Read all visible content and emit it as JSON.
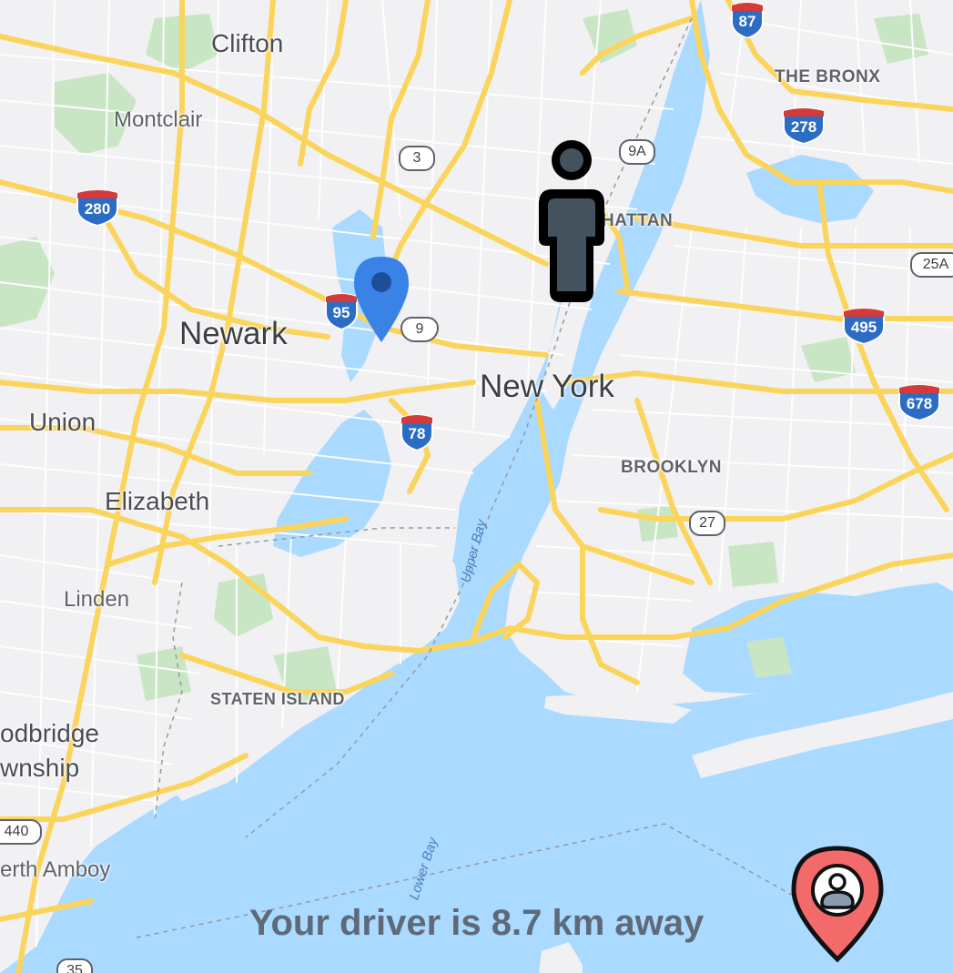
{
  "map": {
    "labels": {
      "clifton": "Clifton",
      "montclair": "Montclair",
      "the_bronx": "THE BRONX",
      "manhattan": "HATTAN",
      "newark": "Newark",
      "new_york": "New York",
      "union": "Union",
      "elizabeth": "Elizabeth",
      "brooklyn": "BROOKLYN",
      "linden": "Linden",
      "staten_island": "STATEN ISLAND",
      "woodbridge_1": "odbridge",
      "woodbridge_2": "wnship",
      "perth_amboy": "erth Amboy"
    },
    "water_labels": {
      "upper_bay": "Upper Bay",
      "lower_bay": "Lower Bay"
    },
    "interstates": {
      "i87": "87",
      "i278": "278",
      "i280": "280",
      "i95": "95",
      "i495": "495",
      "i678": "678",
      "i78": "78"
    },
    "routes": {
      "r3": "3",
      "r9a": "9A",
      "r9": "9",
      "r25a": "25A",
      "r27": "27",
      "r440": "440",
      "r35": "35"
    },
    "markers": {
      "user_icon": "person-icon",
      "pickup_icon": "location-pin-icon",
      "driver_icon": "driver-pin-icon"
    },
    "colors": {
      "water": "#aadaff",
      "land": "#f1f0f3",
      "road": "#fbd55b",
      "park": "#c8e6c4",
      "pin_blue": "#3a83e6",
      "pin_red": "#f26a6a"
    }
  },
  "status": {
    "message": "Your driver is 8.7 km away"
  }
}
